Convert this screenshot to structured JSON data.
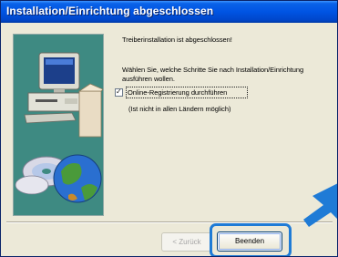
{
  "window": {
    "title": "Installation/Einrichtung abgeschlossen"
  },
  "content": {
    "completed_message": "Treiberinstallation ist abgeschlossen!",
    "instruction_line1": "Wählen Sie, welche Schritte Sie nach Installation/Einrichtung",
    "instruction_line2": "ausführen wollen.",
    "checkbox_label": "Online-Registrierung durchführen",
    "checkbox_checked": true,
    "note": "(Ist nicht in allen Ländern möglich)"
  },
  "buttons": {
    "back_label": "< Zurück",
    "finish_label": "Beenden"
  },
  "colors": {
    "title_bar": "#0054e3",
    "highlight": "#1f7bd6",
    "art_background": "#3e8a82"
  },
  "icons": {
    "computer": "desktop-computer-icon",
    "cd": "cd-disc-icon",
    "globe": "globe-icon",
    "arrow": "pointer-arrow-icon"
  }
}
